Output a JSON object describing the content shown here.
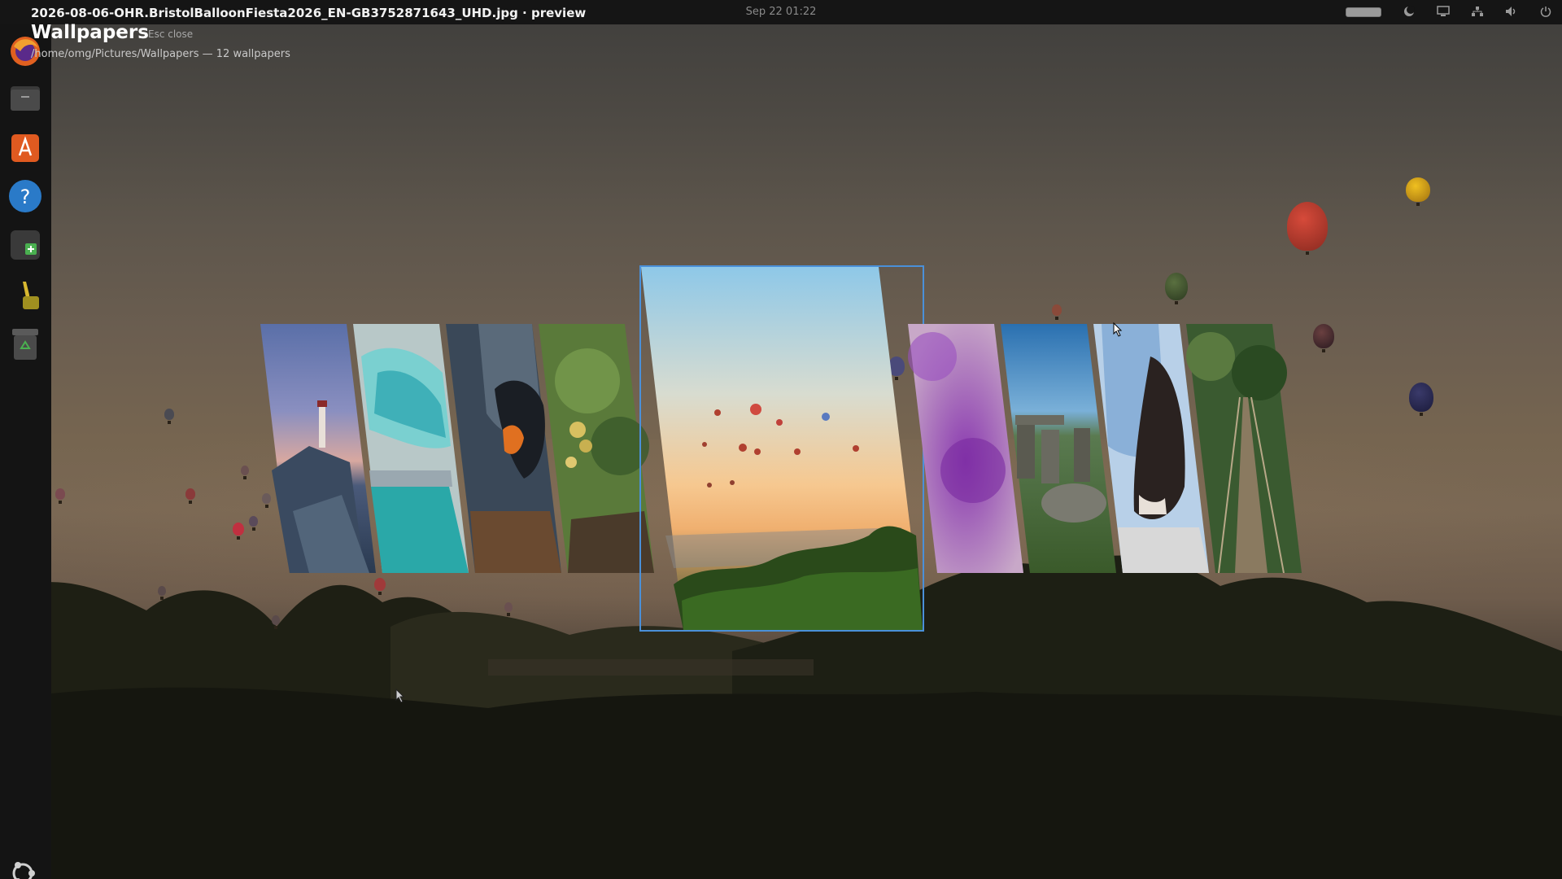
{
  "topbar": {
    "preview_title": "2026-08-06-OHR.BristolBalloonFiesta2026_EN-GB3752871643_UHD.jpg · preview",
    "clock": "Sep 22  01:22",
    "tray_icons": [
      "battery-icon",
      "night-light-icon",
      "display-icon",
      "network-icon",
      "volume-icon",
      "power-icon"
    ]
  },
  "header": {
    "title": "Wallpapers",
    "hint": "Esc close",
    "path": "/home/omg/Pictures/Wallpapers — 12 wallpapers"
  },
  "dock": {
    "items": [
      "firefox-icon",
      "files-icon",
      "app-center-icon",
      "help-icon",
      "extension-icon",
      "tuba-icon",
      "trash-icon"
    ],
    "show_apps": "ubuntu-apps-icon"
  },
  "carousel": {
    "selected_index": 4,
    "selected_color": "#4a90d9",
    "cards": [
      {
        "subject": "lighthouse on rocky shore at dusk"
      },
      {
        "subject": "turquoise iceberg"
      },
      {
        "subject": "king penguin close-up"
      },
      {
        "subject": "green foliage with flowers"
      },
      {
        "subject": "hot-air balloons over sunset valley"
      },
      {
        "subject": "purple abstract blur"
      },
      {
        "subject": "standing stones under blue sky"
      },
      {
        "subject": "dog and person in floral skirt"
      },
      {
        "subject": "rope bridge in forest"
      }
    ]
  }
}
